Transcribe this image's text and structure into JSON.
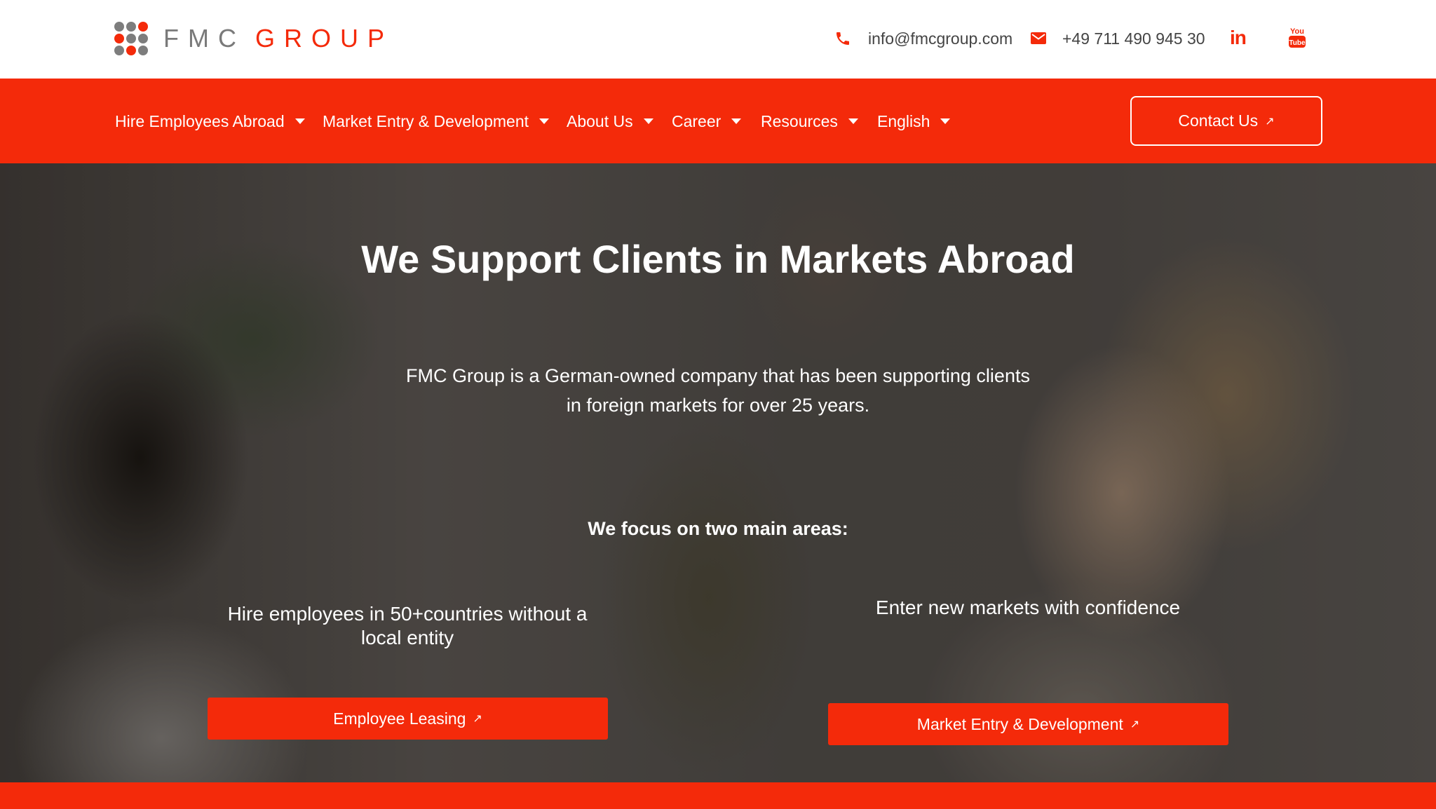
{
  "header": {
    "logo": {
      "word_left": "FMC",
      "word_right": "GROUP"
    },
    "email": "info@fmcgroup.com",
    "phone": "+49 711 490 945 30",
    "linkedin_label": "in",
    "youtube_label_top": "You",
    "youtube_label_bottom": "Tube"
  },
  "nav": {
    "items": [
      {
        "label": "Hire Employees Abroad"
      },
      {
        "label": "Market Entry & Development"
      },
      {
        "label": "About Us"
      },
      {
        "label": "Career"
      },
      {
        "label": "Resources"
      },
      {
        "label": "English"
      }
    ],
    "contact_label": "Contact Us"
  },
  "hero": {
    "title": "We Support Clients in Markets Abroad",
    "description": "FMC Group is a German-owned company that has been supporting clients in foreign markets for over 25 years.",
    "focus": "We focus on two main areas:",
    "columns": [
      {
        "text": "Hire employees in 50+countries without a local entity",
        "button": "Employee Leasing"
      },
      {
        "text": "Enter new markets with confidence",
        "button": "Market Entry & Development"
      }
    ]
  },
  "colors": {
    "brand_red": "#f42a0a",
    "logo_gray": "#7d7d7d",
    "text_dark": "#444444"
  }
}
